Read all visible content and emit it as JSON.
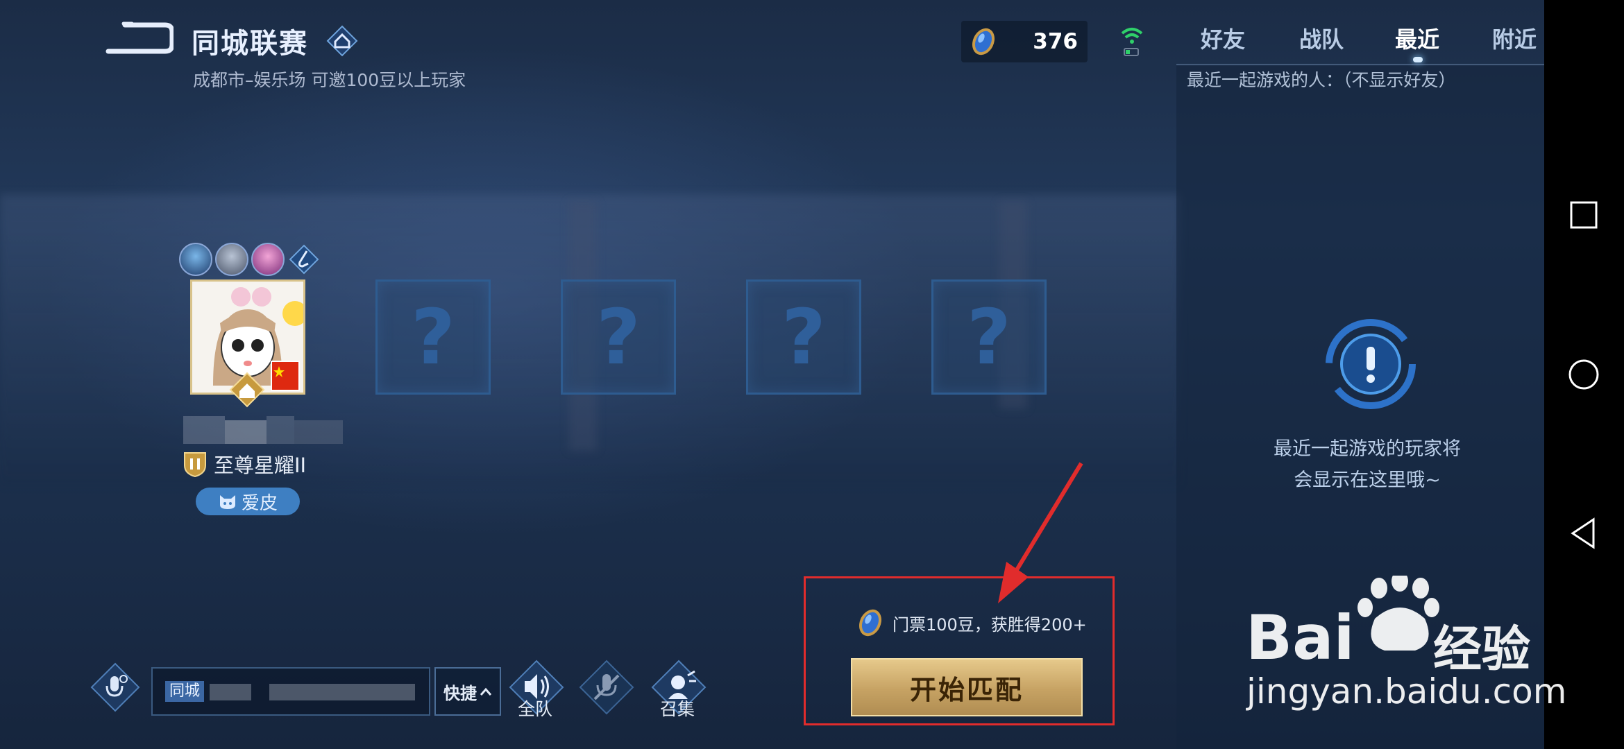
{
  "header": {
    "title": "同城联赛",
    "subtitle": "成都市–娱乐场 可邀100豆以上玩家"
  },
  "currency": {
    "amount": "376",
    "icon": "bean-icon"
  },
  "tabs": [
    {
      "label": "好友",
      "active": false
    },
    {
      "label": "战队",
      "active": false
    },
    {
      "label": "最近",
      "active": true
    },
    {
      "label": "附近",
      "active": false
    }
  ],
  "recent": {
    "label": "最近一起游戏的人：（不显示好友）",
    "empty_message": "最近一起游戏的玩家将\n会显示在这里哦~"
  },
  "player": {
    "rank": "至尊星耀II",
    "tag": "爱皮"
  },
  "slots": [
    "?",
    "?",
    "?",
    "?"
  ],
  "chat": {
    "channel": "同城",
    "quick_label": "快捷",
    "team_label": "全队",
    "summon_label": "召集"
  },
  "match": {
    "ticket_text": "门票100豆，获胜得200+",
    "start_label": "开始匹配"
  },
  "watermark": {
    "brand_latin": "Bai",
    "brand_cn": "经验",
    "url": "jingyan.baidu.com"
  },
  "colors": {
    "highlight": "#e12c2c",
    "start_button": "#c6a263",
    "accent_blue": "#3e7fc2"
  }
}
